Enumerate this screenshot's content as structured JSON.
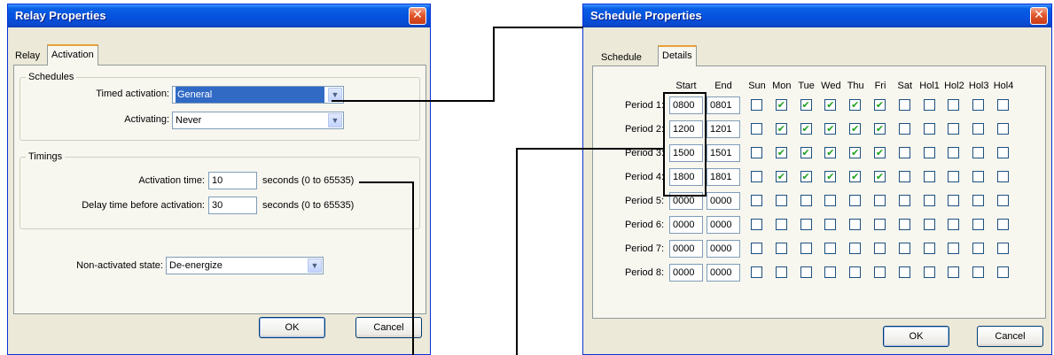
{
  "relay": {
    "title": "Relay Properties",
    "close_glyph": "✕",
    "tabs": [
      "Relay",
      "Activation"
    ],
    "schedules": {
      "group_label": "Schedules",
      "timed_activation_label": "Timed activation:",
      "timed_activation_value": "General",
      "activating_label": "Activating:",
      "activating_value": "Never"
    },
    "timings": {
      "group_label": "Timings",
      "activation_time_label": "Activation time:",
      "activation_time_value": "10",
      "activation_time_unit": "seconds (0 to 65535)",
      "delay_label": "Delay time before activation:",
      "delay_value": "30",
      "delay_unit": "seconds (0 to 65535)"
    },
    "nonactivated_label": "Non-activated state:",
    "nonactivated_value": "De-energize",
    "ok": "OK",
    "cancel": "Cancel"
  },
  "schedule": {
    "title": "Schedule Properties",
    "close_glyph": "✕",
    "tabs": [
      "Schedule",
      "Details"
    ],
    "headers": {
      "start": "Start",
      "end": "End",
      "days": [
        "Sun",
        "Mon",
        "Tue",
        "Wed",
        "Thu",
        "Fri",
        "Sat",
        "Hol1",
        "Hol2",
        "Hol3",
        "Hol4"
      ]
    },
    "periods": [
      {
        "label": "Period 1:",
        "start": "0800",
        "end": "0801",
        "checks": [
          false,
          true,
          true,
          true,
          true,
          true,
          false,
          false,
          false,
          false,
          false
        ]
      },
      {
        "label": "Period 2:",
        "start": "1200",
        "end": "1201",
        "checks": [
          false,
          true,
          true,
          true,
          true,
          true,
          false,
          false,
          false,
          false,
          false
        ]
      },
      {
        "label": "Period 3:",
        "start": "1500",
        "end": "1501",
        "checks": [
          false,
          true,
          true,
          true,
          true,
          true,
          false,
          false,
          false,
          false,
          false
        ]
      },
      {
        "label": "Period 4:",
        "start": "1800",
        "end": "1801",
        "checks": [
          false,
          true,
          true,
          true,
          true,
          true,
          false,
          false,
          false,
          false,
          false
        ]
      },
      {
        "label": "Period 5:",
        "start": "0000",
        "end": "0000",
        "checks": [
          false,
          false,
          false,
          false,
          false,
          false,
          false,
          false,
          false,
          false,
          false
        ]
      },
      {
        "label": "Period 6:",
        "start": "0000",
        "end": "0000",
        "checks": [
          false,
          false,
          false,
          false,
          false,
          false,
          false,
          false,
          false,
          false,
          false
        ]
      },
      {
        "label": "Period 7:",
        "start": "0000",
        "end": "0000",
        "checks": [
          false,
          false,
          false,
          false,
          false,
          false,
          false,
          false,
          false,
          false,
          false
        ]
      },
      {
        "label": "Period 8:",
        "start": "0000",
        "end": "0000",
        "checks": [
          false,
          false,
          false,
          false,
          false,
          false,
          false,
          false,
          false,
          false,
          false
        ]
      }
    ],
    "check_glyph": "✔",
    "ok": "OK",
    "cancel": "Cancel"
  },
  "icons": {
    "close": "close-icon",
    "dropdown": "chevron-down-icon",
    "checkmark": "checkmark-icon"
  },
  "colors": {
    "titlebar": "#0552de",
    "dialog_bg": "#ece9d8",
    "selection": "#316ac5",
    "check": "#21a121",
    "active_tab_accent": "#e8a13a"
  }
}
